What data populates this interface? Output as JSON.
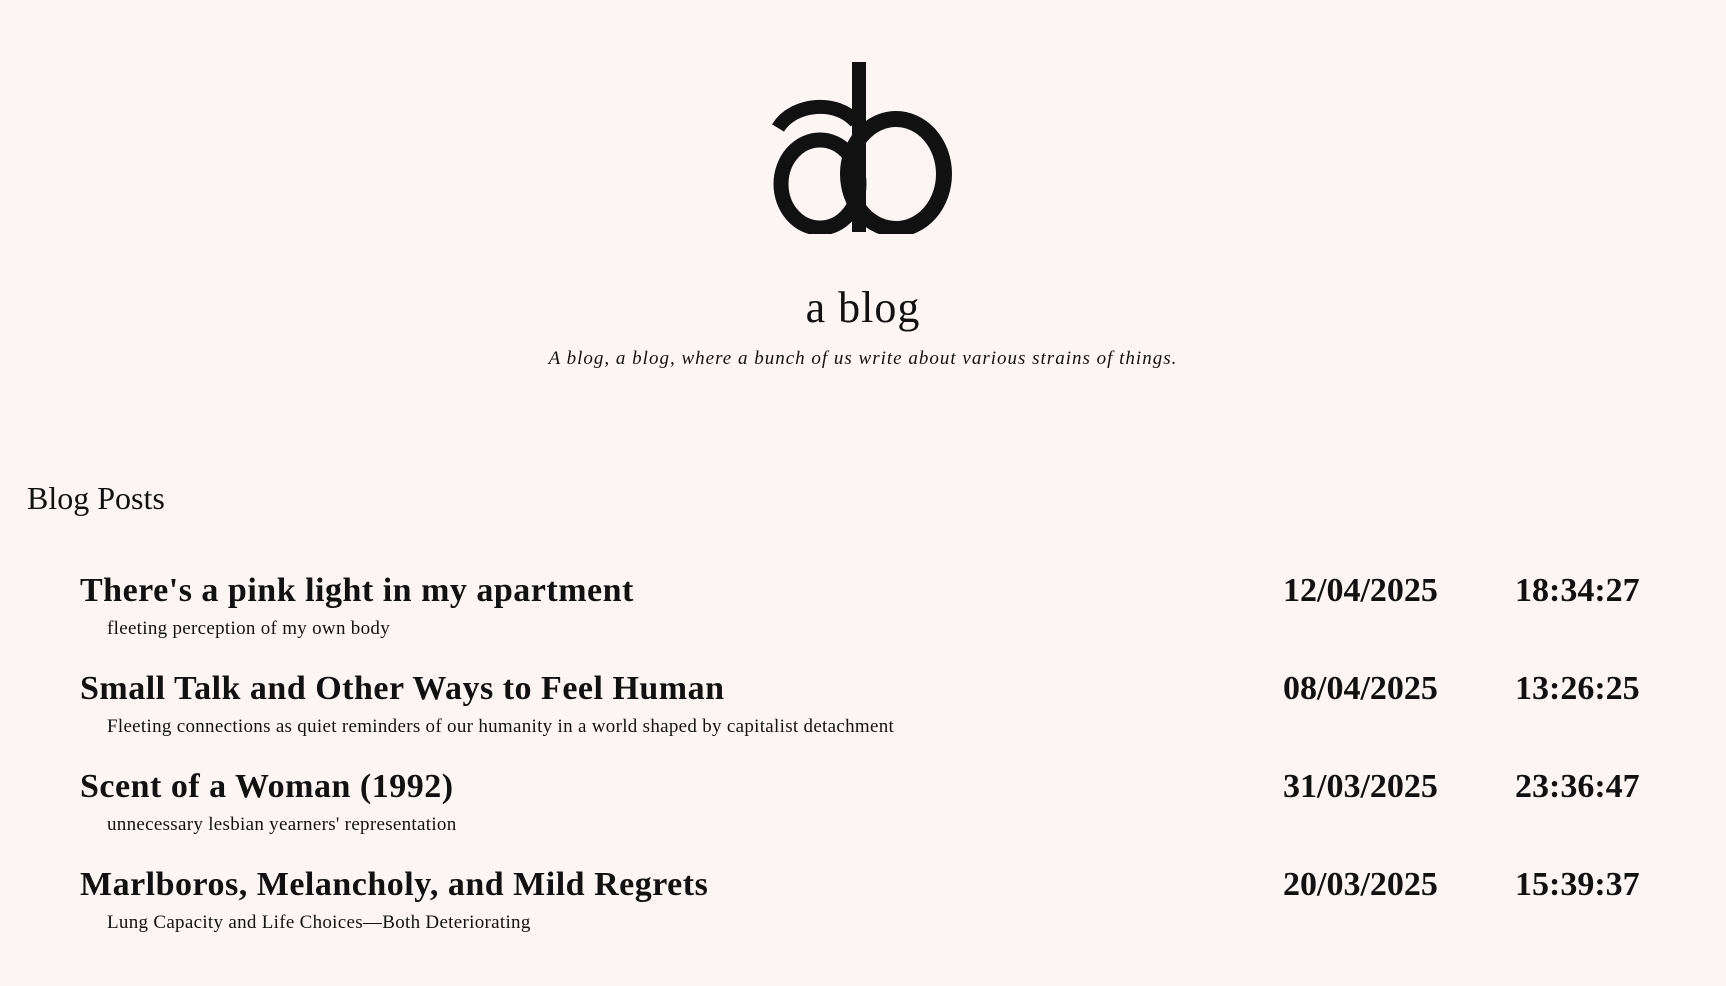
{
  "site": {
    "logo_text": "ab",
    "title": "a blog",
    "tagline": "A blog, a blog, where a bunch of us write about various strains of things."
  },
  "section": {
    "heading": "Blog Posts"
  },
  "posts": [
    {
      "title": "There's a pink light in my apartment",
      "subtitle": "fleeting perception of my own body",
      "date": "12/04/2025",
      "time": "18:34:27"
    },
    {
      "title": "Small Talk and Other Ways to Feel Human",
      "subtitle": "Fleeting connections as quiet reminders of our humanity in a world shaped by capitalist detachment",
      "date": "08/04/2025",
      "time": "13:26:25"
    },
    {
      "title": "Scent of a Woman (1992)",
      "subtitle": "unnecessary lesbian yearners' representation",
      "date": "31/03/2025",
      "time": "23:36:47"
    },
    {
      "title": "Marlboros, Melancholy, and Mild Regrets",
      "subtitle": "Lung Capacity and Life Choices—Both Deteriorating",
      "date": "20/03/2025",
      "time": "15:39:37"
    }
  ]
}
